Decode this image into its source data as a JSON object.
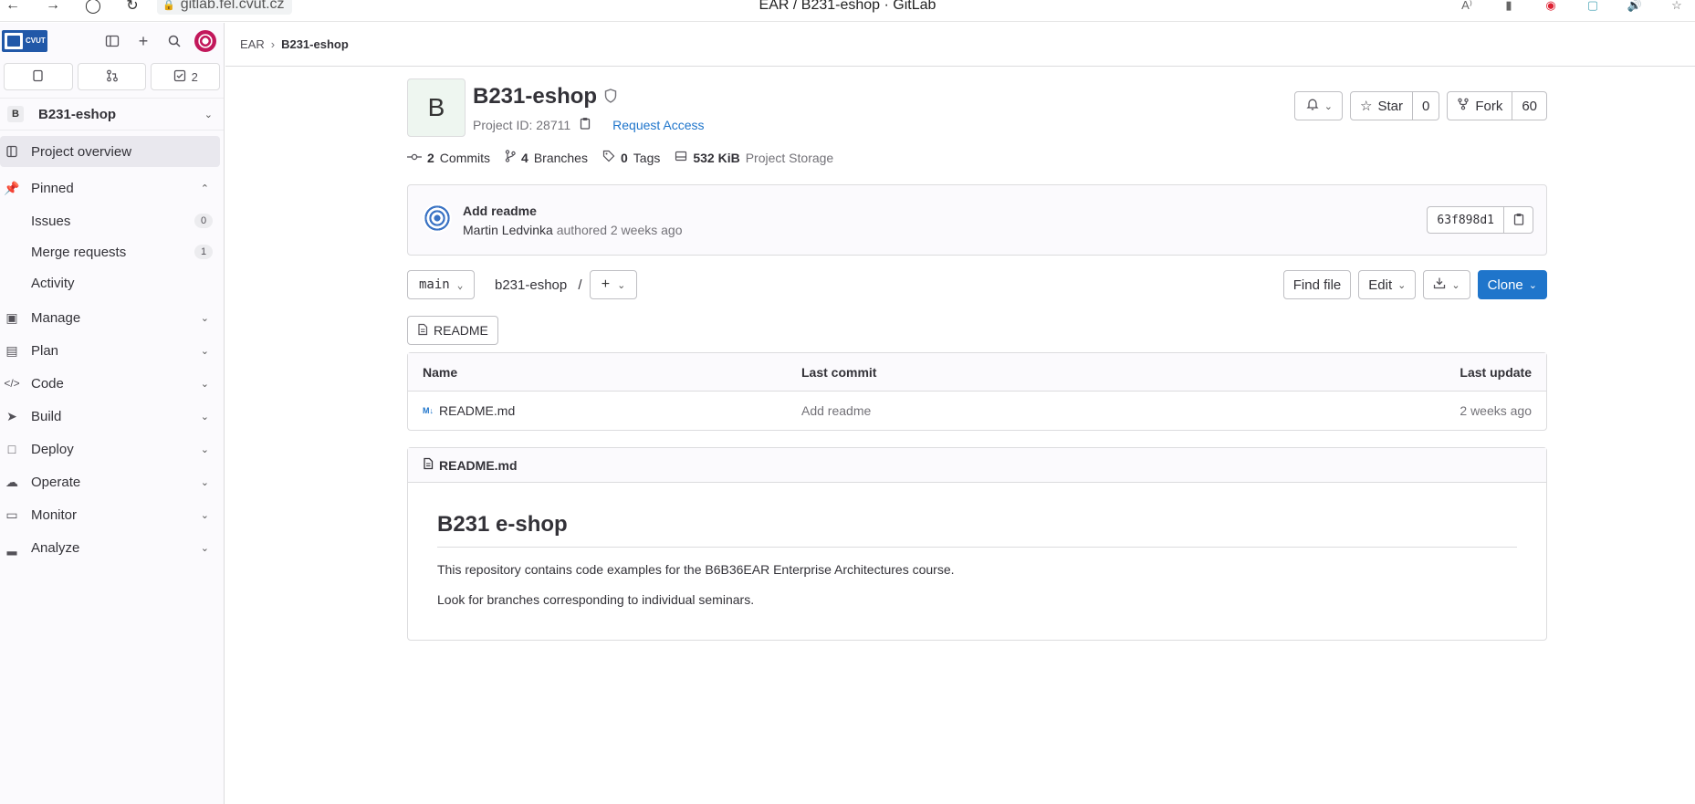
{
  "browser": {
    "url": "gitlab.fel.cvut.cz",
    "tab_title": "EAR / B231-eshop · GitLab"
  },
  "sidebar": {
    "logo_text": "CVUT",
    "counts": {
      "todos": "2"
    },
    "project": {
      "initial": "B",
      "name": "B231-eshop"
    },
    "overview": "Project overview",
    "pinned": {
      "label": "Pinned",
      "items": [
        {
          "label": "Issues",
          "count": "0"
        },
        {
          "label": "Merge requests",
          "count": "1"
        },
        {
          "label": "Activity"
        }
      ]
    },
    "sections": [
      {
        "label": "Manage",
        "icon": "users-icon"
      },
      {
        "label": "Plan",
        "icon": "calendar-icon"
      },
      {
        "label": "Code",
        "icon": "code-icon"
      },
      {
        "label": "Build",
        "icon": "rocket-icon"
      },
      {
        "label": "Deploy",
        "icon": "deploy-icon"
      },
      {
        "label": "Operate",
        "icon": "cloud-gear-icon"
      },
      {
        "label": "Monitor",
        "icon": "monitor-icon"
      },
      {
        "label": "Analyze",
        "icon": "chart-icon"
      }
    ]
  },
  "breadcrumb": {
    "parent": "EAR",
    "current": "B231-eshop"
  },
  "project": {
    "avatar_initial": "B",
    "title": "B231-eshop",
    "id_label": "Project ID: 28711",
    "request_access": "Request Access",
    "star_label": "Star",
    "star_count": "0",
    "fork_label": "Fork",
    "fork_count": "60",
    "stats": {
      "commits_num": "2",
      "commits_label": "Commits",
      "branches_num": "4",
      "branches_label": "Branches",
      "tags_num": "0",
      "tags_label": "Tags",
      "storage_num": "532 KiB",
      "storage_label": "Project Storage"
    }
  },
  "last_commit": {
    "title": "Add readme",
    "author": "Martin Ledvinka",
    "meta": "authored 2 weeks ago",
    "sha": "63f898d1"
  },
  "tree": {
    "branch": "main",
    "path": "b231-eshop",
    "path_sep": "/",
    "find_file": "Find file",
    "edit": "Edit",
    "clone": "Clone",
    "readme_button": "README"
  },
  "files": {
    "headers": {
      "name": "Name",
      "last_commit": "Last commit",
      "last_update": "Last update"
    },
    "rows": [
      {
        "name": "README.md",
        "commit": "Add readme",
        "updated": "2 weeks ago"
      }
    ]
  },
  "readme": {
    "filename": "README.md",
    "heading": "B231 e-shop",
    "paragraphs": [
      "This repository contains code examples for the B6B36EAR Enterprise Architectures course.",
      "Look for branches corresponding to individual seminars."
    ]
  },
  "colors": {
    "accent": "#1f75cb",
    "sidebar_bg": "#fbfafd"
  }
}
